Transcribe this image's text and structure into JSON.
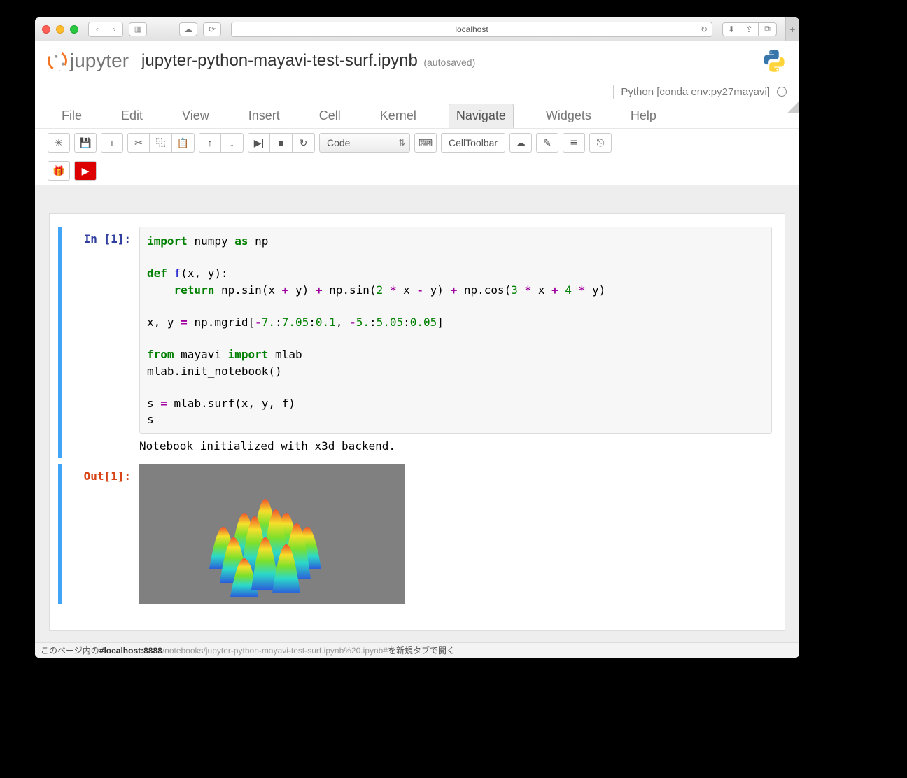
{
  "browser": {
    "url_display": "localhost",
    "nav_back": "‹",
    "nav_fwd": "›",
    "sidebar_toggle": "▥",
    "cloud_icon": "☁",
    "refresh_icon": "⟳",
    "reload_icon": "↻",
    "download_icon": "⬇",
    "share_icon": "⇪",
    "tabs_icon": "⧉",
    "plus": "+"
  },
  "header": {
    "logo_text": "jupyter",
    "notebook_title": "jupyter-python-mayavi-test-surf.ipynb",
    "autosave": "(autosaved)"
  },
  "kernel": {
    "name": "Python [conda env:py27mayavi]"
  },
  "menu": {
    "file": "File",
    "edit": "Edit",
    "view": "View",
    "insert": "Insert",
    "cell": "Cell",
    "kernel": "Kernel",
    "navigate": "Navigate",
    "widgets": "Widgets",
    "help": "Help"
  },
  "toolbar": {
    "celltype": "Code",
    "celltoolbar": "CellToolbar",
    "icons": {
      "save": "✳",
      "disk": "💾",
      "add": "+",
      "cut": "✂",
      "copy": "⿻",
      "paste": "📋",
      "up": "↑",
      "down": "↓",
      "run": "▶|",
      "stop": "■",
      "restart": "↻",
      "keyboard": "⌨",
      "cloud": "☁",
      "paint": "✎",
      "toc": "≣",
      "github": "⎋",
      "gift": "🎁",
      "youtube": "▶"
    }
  },
  "cells": {
    "in_prompt": "In [1]:",
    "code_tokens": {
      "t01": "import",
      "t02": "numpy",
      "t03": "as",
      "t04": "np",
      "t05": "def",
      "t06": "f",
      "t07": "(x, y):",
      "t08": "return",
      "t09": "np",
      "t10": ".sin(x ",
      "t11": "+",
      "t12": " y) ",
      "t13": "+",
      "t14": " np",
      "t15": ".sin(",
      "t16": "2",
      "t17": " ",
      "t18": "*",
      "t19": " x ",
      "t20": "-",
      "t21": " y) ",
      "t22": "+",
      "t23": " np",
      "t24": ".cos(",
      "t25": "3",
      "t26": " ",
      "t27": "*",
      "t28": " x ",
      "t29": "+",
      "t30": " ",
      "t31": "4",
      "t32": " ",
      "t33": "*",
      "t34": " y)",
      "t35": "x, y ",
      "t36": "=",
      "t37": " np",
      "t38": ".mgrid[",
      "t39": "-",
      "t40": "7.",
      "t41": ":",
      "t42": "7.05",
      "t43": ":",
      "t44": "0.1",
      "t45": ", ",
      "t46": "-",
      "t47": "5.",
      "t48": ":",
      "t49": "5.05",
      "t50": ":",
      "t51": "0.05",
      "t52": "]",
      "t60": "from",
      "t61": "mayavi",
      "t62": "import",
      "t63": "mlab",
      "t64": "mlab",
      "t65": ".init_notebook()",
      "t70": "s ",
      "t71": "=",
      "t72": " mlab",
      "t73": ".surf(x, y, f)",
      "t74": "s"
    },
    "stream": "Notebook initialized with x3d backend.",
    "out_prompt": "Out[1]:"
  },
  "status": {
    "pre": "このページ内の",
    "host": "#localhost:8888",
    "path": "/notebooks/jupyter-python-mayavi-test-surf.ipynb%20.ipynb#",
    "post": "を新規タブで開く"
  }
}
